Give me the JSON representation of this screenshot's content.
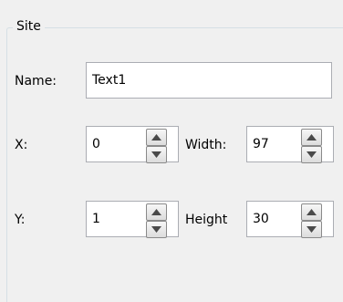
{
  "group": {
    "title": "Site"
  },
  "name": {
    "label": "Name:",
    "value": "Text1"
  },
  "x": {
    "label": "X:",
    "value": "0"
  },
  "y": {
    "label": "Y:",
    "value": "1"
  },
  "width": {
    "label": "Width:",
    "value": "97"
  },
  "height": {
    "label": "Height",
    "value": "30"
  }
}
